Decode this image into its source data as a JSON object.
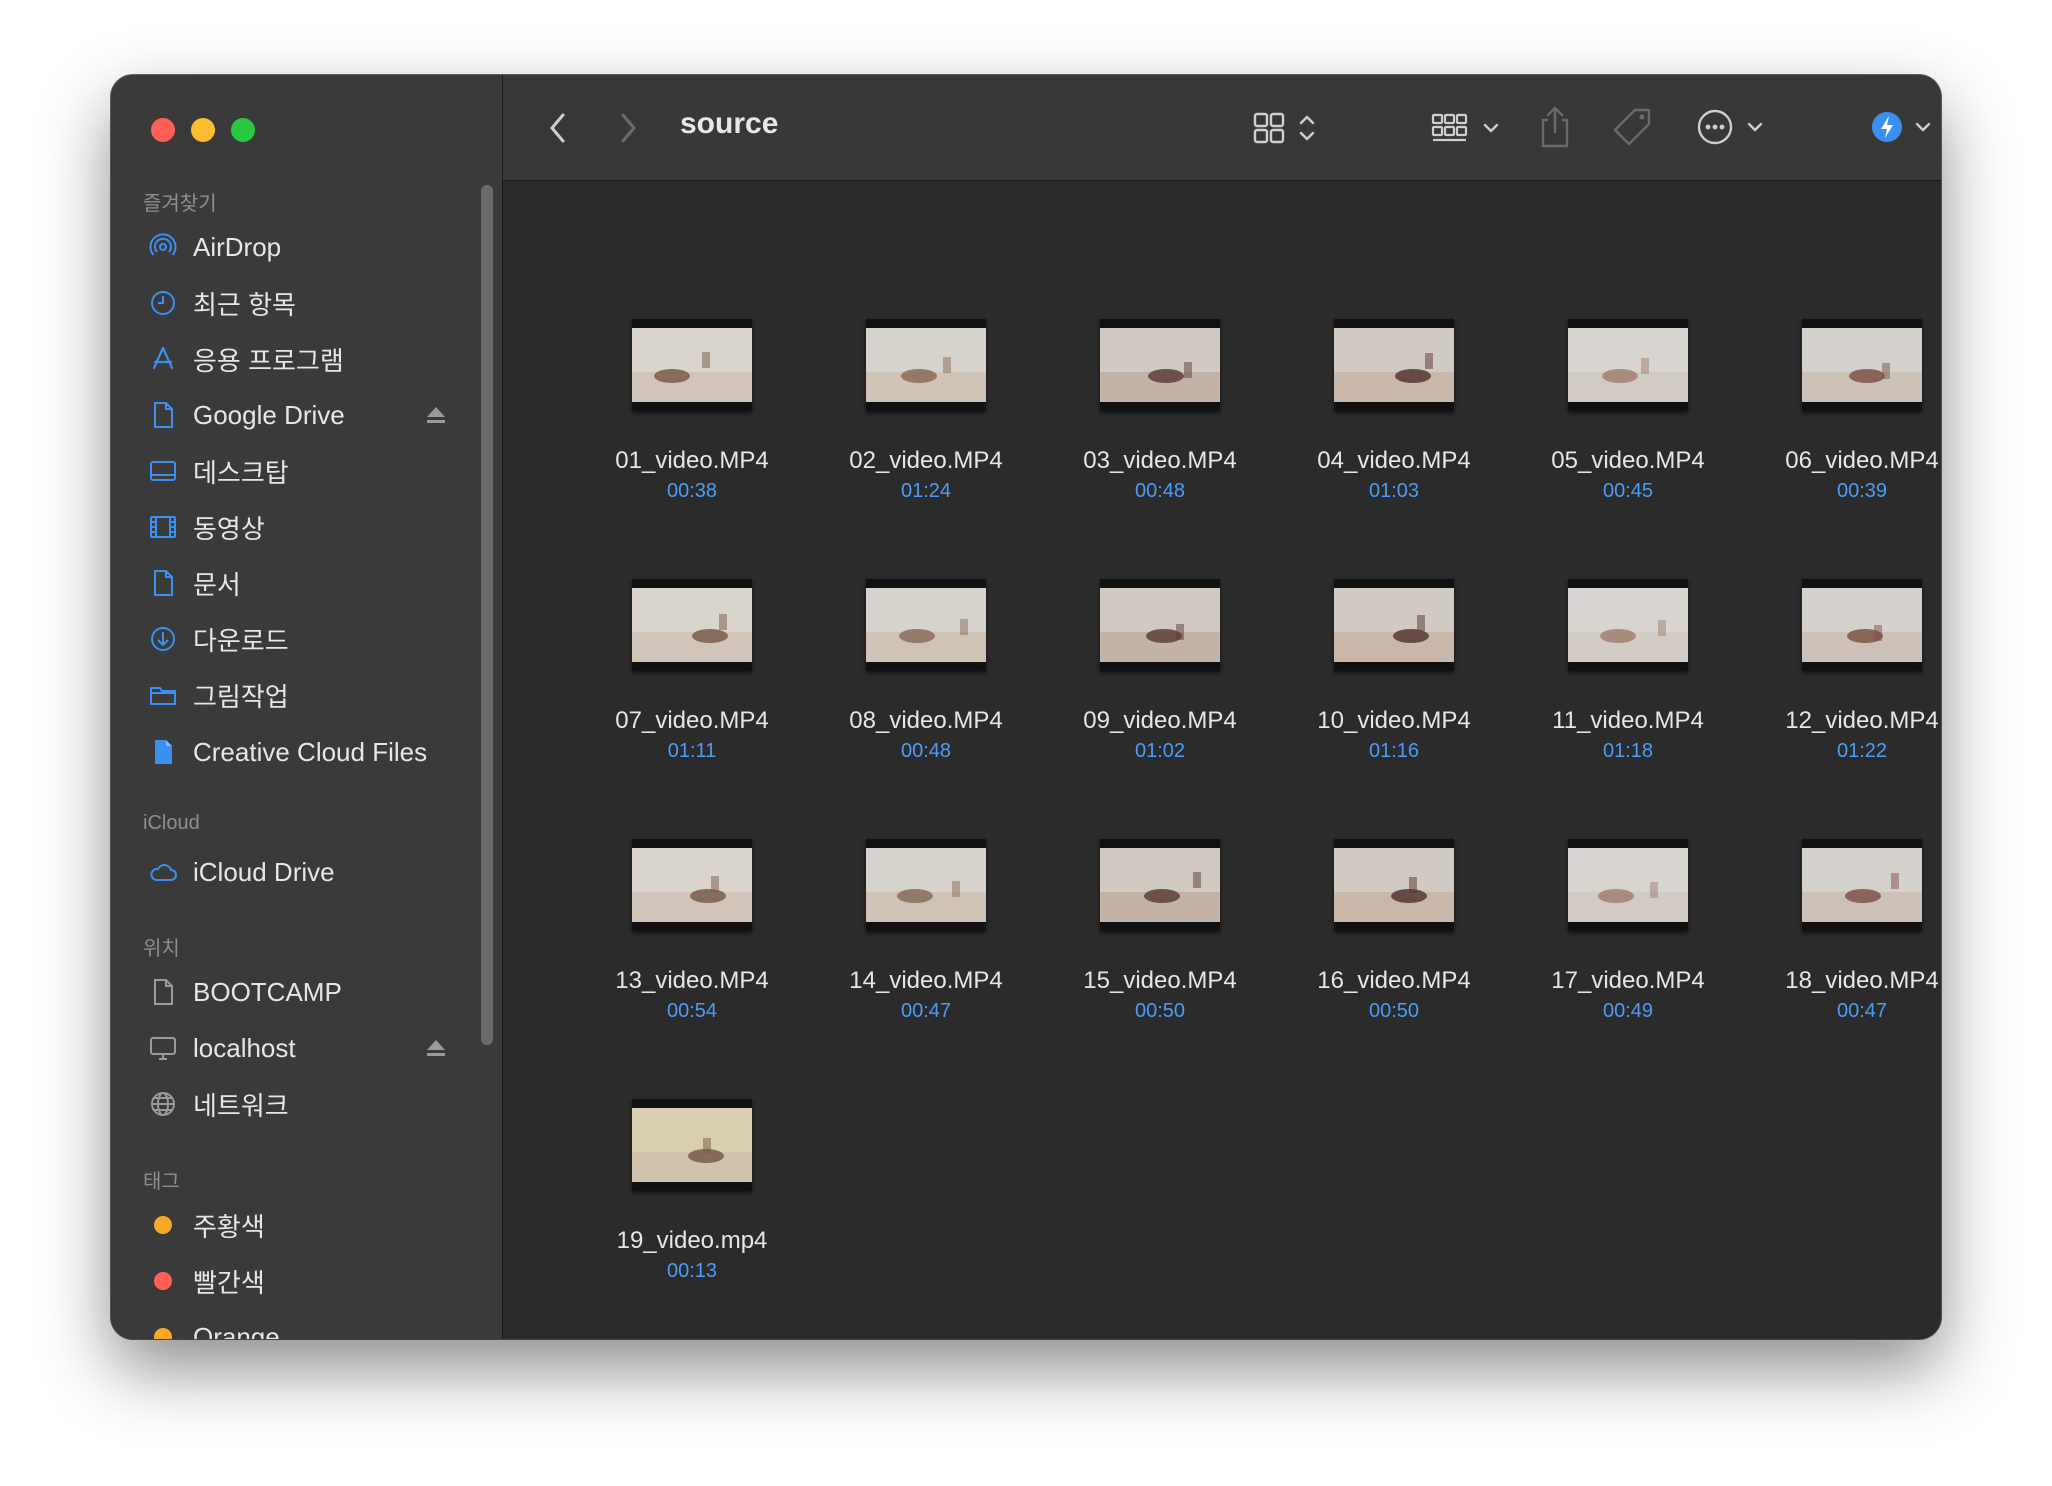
{
  "window": {
    "title": "source"
  },
  "colors": {
    "accent": "#4a9df8",
    "sidebar_bg": "#3b3a3a",
    "content_bg": "#2b2b2b",
    "toolbar_bg": "#393838",
    "tag_orange": "#f9a825",
    "tag_red": "#ff5f57"
  },
  "sidebar": {
    "favorites": {
      "title": "즐겨찾기",
      "items": [
        {
          "label": "AirDrop",
          "icon": "airdrop-icon"
        },
        {
          "label": "최근 항목",
          "icon": "clock-icon"
        },
        {
          "label": "응용 프로그램",
          "icon": "applications-icon"
        },
        {
          "label": "Google Drive",
          "icon": "document-icon"
        },
        {
          "label": "데스크탑",
          "icon": "desktop-icon"
        },
        {
          "label": "동영상",
          "icon": "film-icon"
        },
        {
          "label": "문서",
          "icon": "document-icon"
        },
        {
          "label": "다운로드",
          "icon": "download-icon"
        },
        {
          "label": "그림작업",
          "icon": "folder-icon"
        },
        {
          "label": "Creative Cloud Files",
          "icon": "document-filled-icon"
        }
      ]
    },
    "icloud": {
      "title": "iCloud",
      "items": [
        {
          "label": "iCloud Drive",
          "icon": "cloud-icon"
        }
      ]
    },
    "locations": {
      "title": "위치",
      "items": [
        {
          "label": "BOOTCAMP",
          "icon": "drive-icon"
        },
        {
          "label": "localhost",
          "icon": "display-icon"
        },
        {
          "label": "네트워크",
          "icon": "globe-icon"
        }
      ]
    },
    "tags": {
      "title": "태그",
      "items": [
        {
          "label": "주황색",
          "color": "#f9a825"
        },
        {
          "label": "빨간색",
          "color": "#ff5f57"
        },
        {
          "label": "Orange",
          "color": "#f9a825"
        }
      ]
    }
  },
  "toolbar": {
    "back": "chevron-left-icon",
    "forward": "chevron-right-icon",
    "view_mode": "grid-view-icon",
    "group": "group-by-icon",
    "share": "share-icon",
    "tag": "tag-icon",
    "more": "more-icon",
    "airdrop": "airdrop-action-icon",
    "search": "search-icon"
  },
  "files": [
    {
      "name": "01_video.MP4",
      "duration": "00:38"
    },
    {
      "name": "02_video.MP4",
      "duration": "01:24"
    },
    {
      "name": "03_video.MP4",
      "duration": "00:48"
    },
    {
      "name": "04_video.MP4",
      "duration": "01:03"
    },
    {
      "name": "05_video.MP4",
      "duration": "00:45"
    },
    {
      "name": "06_video.MP4",
      "duration": "00:39"
    },
    {
      "name": "07_video.MP4",
      "duration": "01:11"
    },
    {
      "name": "08_video.MP4",
      "duration": "00:48"
    },
    {
      "name": "09_video.MP4",
      "duration": "01:02"
    },
    {
      "name": "10_video.MP4",
      "duration": "01:16"
    },
    {
      "name": "11_video.MP4",
      "duration": "01:18"
    },
    {
      "name": "12_video.MP4",
      "duration": "01:22"
    },
    {
      "name": "13_video.MP4",
      "duration": "00:54"
    },
    {
      "name": "14_video.MP4",
      "duration": "00:47"
    },
    {
      "name": "15_video.MP4",
      "duration": "00:50"
    },
    {
      "name": "16_video.MP4",
      "duration": "00:50"
    },
    {
      "name": "17_video.MP4",
      "duration": "00:49"
    },
    {
      "name": "18_video.MP4",
      "duration": "00:47"
    },
    {
      "name": "19_video.mp4",
      "duration": "00:13"
    }
  ]
}
